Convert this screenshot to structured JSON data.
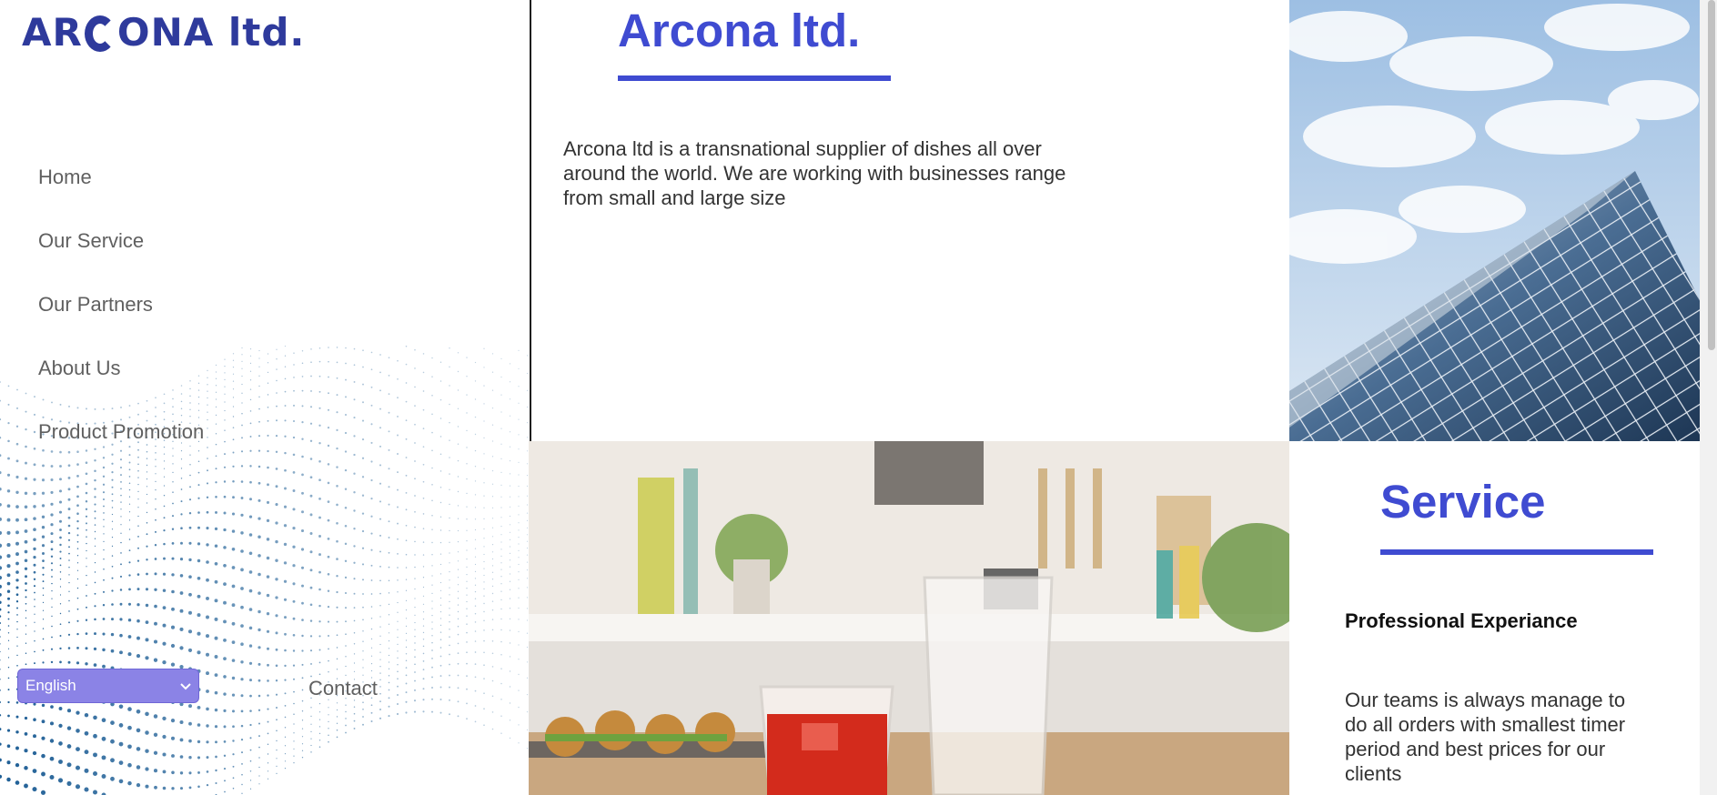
{
  "sidebar": {
    "logo_text": "AR",
    "logo_text_end": "ONA ltd.",
    "nav": [
      {
        "label": "Home"
      },
      {
        "label": "Our Service"
      },
      {
        "label": "Our Partners"
      },
      {
        "label": "About Us"
      },
      {
        "label": "Product Promotion"
      }
    ],
    "language": {
      "selected": "English"
    },
    "contact_label": "Contact"
  },
  "intro": {
    "title": "Arcona ltd.",
    "body": "Arcona ltd is a transnational supplier of dishes all over around the world. We are working with businesses range from small and large size"
  },
  "service": {
    "title": "Service",
    "subtitle": "Professional Experiance",
    "body": "Our teams is always manage to do all orders with smallest timer period and best prices for our clients"
  },
  "colors": {
    "accent": "#3f4bd1",
    "logo": "#2e3a9c",
    "language_select": "#8b83e6",
    "nav_text": "#606060"
  },
  "icons": {
    "select_chevron": "chevron-down-icon"
  }
}
